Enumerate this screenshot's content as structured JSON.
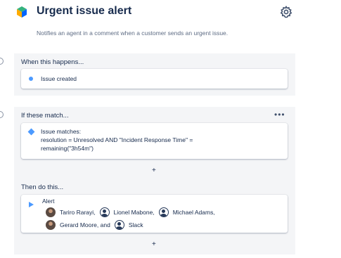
{
  "header": {
    "title": "Urgent issue alert",
    "description": "Notifies an agent in a comment when a customer sends an urgent issue.",
    "icons": {
      "app": "automation-rule-icon",
      "settings": "gear-icon"
    }
  },
  "trigger": {
    "heading": "When this happens...",
    "item": "Issue created",
    "icon": "dot-icon"
  },
  "condition": {
    "heading": "If these match...",
    "more_label": "•••",
    "line1": "Issue matches:",
    "line2": "resolution = Unresolved AND \"Incident Response Time\" =",
    "line3": "remaining(\"3h54m\")",
    "add_label": "+"
  },
  "action": {
    "heading": "Then do this...",
    "title": "Alert",
    "recipients": [
      {
        "name": "Tariro Rarayi,",
        "avatar": "photo"
      },
      {
        "name": "Lionel Mabone,",
        "avatar": "generic"
      },
      {
        "name": "Michael Adams,",
        "avatar": "generic"
      },
      {
        "name": "Gerard Moore, and",
        "avatar": "photo"
      },
      {
        "name": "Slack",
        "avatar": "generic"
      }
    ],
    "add_label": "+"
  },
  "colors": {
    "accent": "#4c9aff",
    "section_bg": "#f4f5f7",
    "text": "#172b4d"
  }
}
